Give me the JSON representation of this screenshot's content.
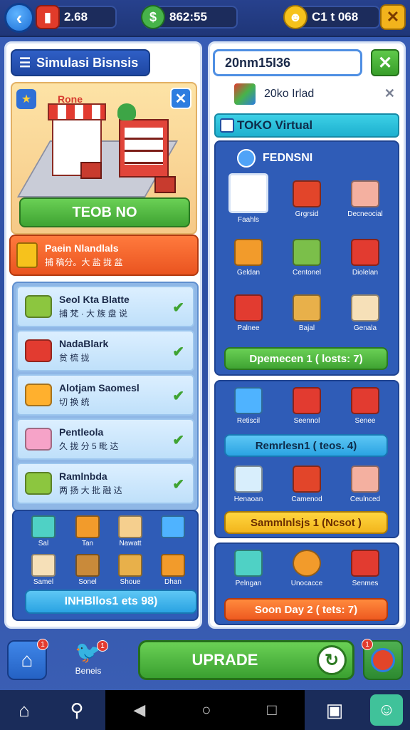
{
  "topbar": {
    "res1_value": "2.68",
    "res2_value": "862:55",
    "res3_value": "C1 t 068"
  },
  "left": {
    "title": "Simulasi Bisnsis",
    "scene_sign": "Rone",
    "scene_button": "TEOB NO",
    "banner": {
      "line1": "Paein Nlandlals",
      "line2": "捕 稿分。大 盐 拢 盆"
    },
    "rows": [
      {
        "title": "Seol Kta Blatte",
        "sub": "捕 梵 · 大 族 盘 说",
        "color": "#8cc63f"
      },
      {
        "title": "NadaBlark",
        "sub": "贫 梳 拢",
        "color": "#e23b30"
      },
      {
        "title": "Alotjam Saomesl",
        "sub": "切 换 统",
        "color": "#ffb02e"
      },
      {
        "title": "Pentleola",
        "sub": "久 拢 分 5 毗 达",
        "color": "#f6a3c8"
      },
      {
        "title": "Ramlnbda",
        "sub": "两 扬 大 批 融 达",
        "color": "#8cc63f"
      }
    ],
    "grid": [
      {
        "label": "Sal",
        "color": "#4fd1c5"
      },
      {
        "label": "Tan",
        "color": "#f29b2b"
      },
      {
        "label": "Nawatt",
        "color": "#f5cf8e"
      },
      {
        "label": "",
        "color": "#4fb3ff"
      },
      {
        "label": "Samel",
        "color": "#f6e0b8"
      },
      {
        "label": "Sonel",
        "color": "#c98a3a"
      },
      {
        "label": "Shoue",
        "color": "#e8b04a"
      },
      {
        "label": "Dhan",
        "color": "#f29b2b"
      }
    ],
    "grid_button": "INHBllos1 ets 98)"
  },
  "right": {
    "search_value": "20nm15I36",
    "store_name": "20ko Irlad",
    "toko_label": "TOKO Virtual",
    "section1_title": "FEDNSNI",
    "section1_items": [
      {
        "label": "Faahls",
        "color": "#ffffff",
        "sel": true
      },
      {
        "label": "Grgrsid",
        "color": "#e2452a"
      },
      {
        "label": "Decneocial",
        "color": "#f4b0a0"
      },
      {
        "label": "Geldan",
        "color": "#f29b2b"
      },
      {
        "label": "Centonel",
        "color": "#7bbf4a"
      },
      {
        "label": "Diolelan",
        "color": "#e23b30"
      },
      {
        "label": "Palnee",
        "color": "#e23b30"
      },
      {
        "label": "Bajal",
        "color": "#e8b04a"
      },
      {
        "label": "Genala",
        "color": "#f6e0b8"
      }
    ],
    "section1_button": "Dpemecen 1 ( losts: 7)",
    "section2_items": [
      {
        "label": "Retiscil",
        "color": "#4fb3ff"
      },
      {
        "label": "Seennol",
        "color": "#e23b30"
      },
      {
        "label": "Senee",
        "color": "#e23b30"
      }
    ],
    "section2_button": "Remrlesn1 ( teos. 4)",
    "section2_items_b": [
      {
        "label": "Henaoan",
        "color": "#d8eefc"
      },
      {
        "label": "Camenod",
        "color": "#e2452a"
      },
      {
        "label": "Ceulnced",
        "color": "#f4b0a0"
      }
    ],
    "section2_button_b": "Sammlnlsjs 1 (Ncsot )",
    "section3_items": [
      {
        "label": "Pelngan",
        "color": "#4fd1c5"
      },
      {
        "label": "Unocacce",
        "color": "#f29b2b"
      },
      {
        "label": "Senmes",
        "color": "#e23b30"
      }
    ],
    "section3_button": "Soon Day 2 ( tets: 7)"
  },
  "bottom": {
    "home_badge": "1",
    "bird_label": "Beneis",
    "bird_badge": "1",
    "upgrade_label": "UPRADE",
    "red_badge": "1"
  }
}
